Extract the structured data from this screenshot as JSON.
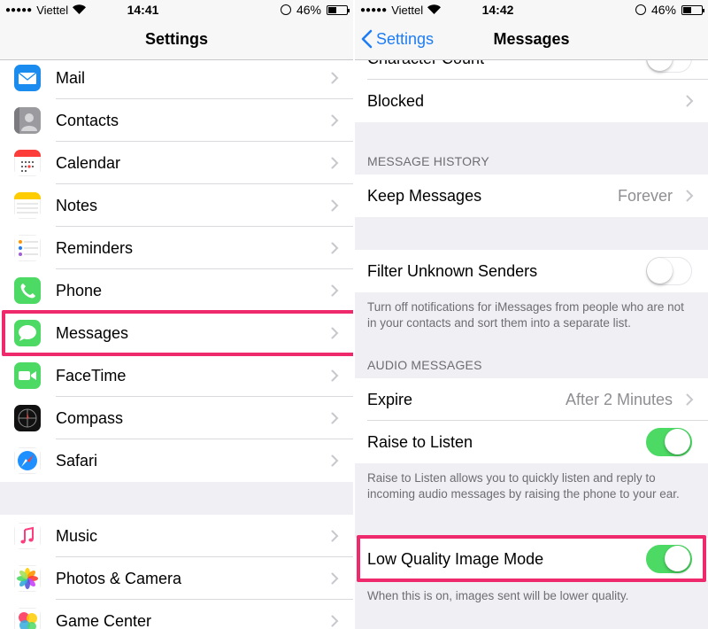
{
  "left": {
    "status": {
      "carrier": "Viettel",
      "time": "14:41",
      "battery": "46%",
      "battery_level": 0.46
    },
    "nav": {
      "title": "Settings"
    },
    "group1": [
      {
        "label": "Mail",
        "icon": "mail-icon"
      },
      {
        "label": "Contacts",
        "icon": "contacts-icon"
      },
      {
        "label": "Calendar",
        "icon": "calendar-icon"
      },
      {
        "label": "Notes",
        "icon": "notes-icon"
      },
      {
        "label": "Reminders",
        "icon": "reminders-icon"
      },
      {
        "label": "Phone",
        "icon": "phone-icon"
      },
      {
        "label": "Messages",
        "icon": "messages-icon"
      },
      {
        "label": "FaceTime",
        "icon": "facetime-icon"
      },
      {
        "label": "Compass",
        "icon": "compass-icon"
      },
      {
        "label": "Safari",
        "icon": "safari-icon"
      }
    ],
    "group2": [
      {
        "label": "Music",
        "icon": "music-icon"
      },
      {
        "label": "Photos & Camera",
        "icon": "photos-icon"
      },
      {
        "label": "Game Center",
        "icon": "game-center-icon"
      }
    ]
  },
  "right": {
    "status": {
      "carrier": "Viettel",
      "time": "14:42",
      "battery": "46%",
      "battery_level": 0.46
    },
    "nav": {
      "back": "Settings",
      "title": "Messages"
    },
    "partial_row": {
      "label": "Character Count",
      "on": false
    },
    "blocked": {
      "label": "Blocked"
    },
    "history_header": "MESSAGE HISTORY",
    "keep_messages": {
      "label": "Keep Messages",
      "value": "Forever"
    },
    "filter": {
      "label": "Filter Unknown Senders",
      "on": false,
      "footer": "Turn off notifications for iMessages from people who are not in your contacts and sort them into a separate list."
    },
    "audio_header": "AUDIO MESSAGES",
    "expire": {
      "label": "Expire",
      "value": "After 2 Minutes"
    },
    "raise": {
      "label": "Raise to Listen",
      "on": true,
      "footer": "Raise to Listen allows you to quickly listen and reply to incoming audio messages by raising the phone to your ear."
    },
    "low_quality": {
      "label": "Low Quality Image Mode",
      "on": true,
      "footer": "When this is on, images sent will be lower quality."
    }
  },
  "colors": {
    "highlight": "#ee2a6c",
    "accent": "#1e7cf4",
    "toggle_on": "#4cd964"
  }
}
